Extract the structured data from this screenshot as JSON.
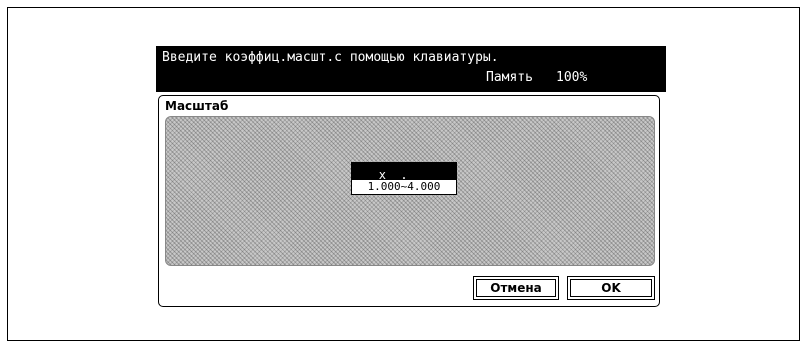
{
  "banner": {
    "message": "Введите коэффиц.масшт.с помощью клавиатуры.",
    "memory_label": "Память",
    "memory_value": "100%"
  },
  "panel": {
    "title": "Масштаб"
  },
  "entry": {
    "value": "x _.___",
    "range": "1.000~4.000"
  },
  "buttons": {
    "cancel": "Отмена",
    "ok": "OK"
  }
}
